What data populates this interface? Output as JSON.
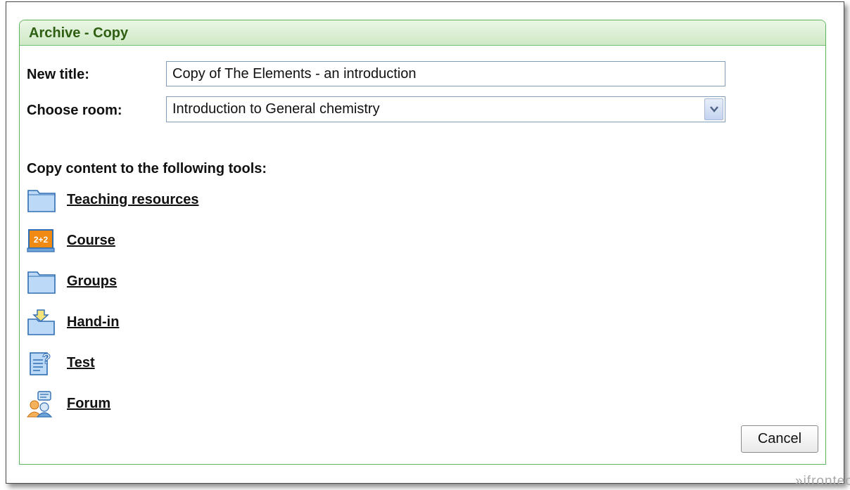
{
  "dialog": {
    "title": "Archive - Copy",
    "new_title_label": "New title:",
    "new_title_value": "Copy of The Elements - an introduction",
    "choose_room_label": "Choose room:",
    "choose_room_value": "Introduction to General chemistry",
    "tools_heading": "Copy content to the following tools:",
    "tools": [
      {
        "label": "Teaching resources",
        "icon": "folder-icon"
      },
      {
        "label": "Course",
        "icon": "course-icon"
      },
      {
        "label": "Groups",
        "icon": "folder-icon"
      },
      {
        "label": "Hand-in",
        "icon": "hand-in-icon"
      },
      {
        "label": "Test",
        "icon": "test-icon"
      },
      {
        "label": "Forum",
        "icon": "forum-icon"
      }
    ],
    "cancel_label": "Cancel"
  },
  "watermark": "»ifrontec",
  "colors": {
    "panel_border": "#5bb35b",
    "header_text": "#2f5f12",
    "folder_fill": "#b7d8f7",
    "course_accent": "#f08a12"
  }
}
